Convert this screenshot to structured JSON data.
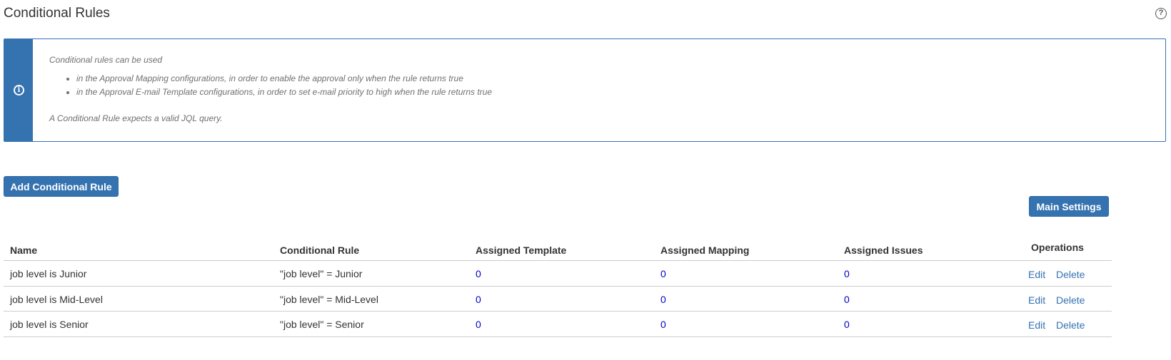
{
  "header": {
    "title": "Conditional Rules",
    "help_icon": "question-circle-icon",
    "help_glyph": "?"
  },
  "info": {
    "icon": "info-circle-icon",
    "icon_glyph": "i",
    "intro": "Conditional rules can be used",
    "items": [
      "in the Approval Mapping configurations, in order to enable the approval only when the rule returns true",
      "in the Approval E-mail Template configurations, in order to set e-mail priority to high when the rule returns true"
    ],
    "footer": "A Conditional Rule expects a valid JQL query."
  },
  "actions": {
    "add_label": "Add Conditional Rule",
    "main_settings_label": "Main Settings"
  },
  "table": {
    "headers": {
      "name": "Name",
      "rule": "Conditional Rule",
      "template": "Assigned Template",
      "mapping": "Assigned Mapping",
      "issues": "Assigned Issues",
      "operations": "Operations"
    },
    "rows": [
      {
        "name": "job level is Junior",
        "rule": "\"job level\" = Junior",
        "template": "0",
        "mapping": "0",
        "issues": "0",
        "edit": "Edit",
        "delete": "Delete"
      },
      {
        "name": "job level is Mid-Level",
        "rule": "\"job level\" = Mid-Level",
        "template": "0",
        "mapping": "0",
        "issues": "0",
        "edit": "Edit",
        "delete": "Delete"
      },
      {
        "name": "job level is Senior",
        "rule": "\"job level\" = Senior",
        "template": "0",
        "mapping": "0",
        "issues": "0",
        "edit": "Edit",
        "delete": "Delete"
      }
    ]
  },
  "colors": {
    "accent": "#3572b0",
    "count_link": "#0000cc",
    "border": "#cccccc"
  }
}
